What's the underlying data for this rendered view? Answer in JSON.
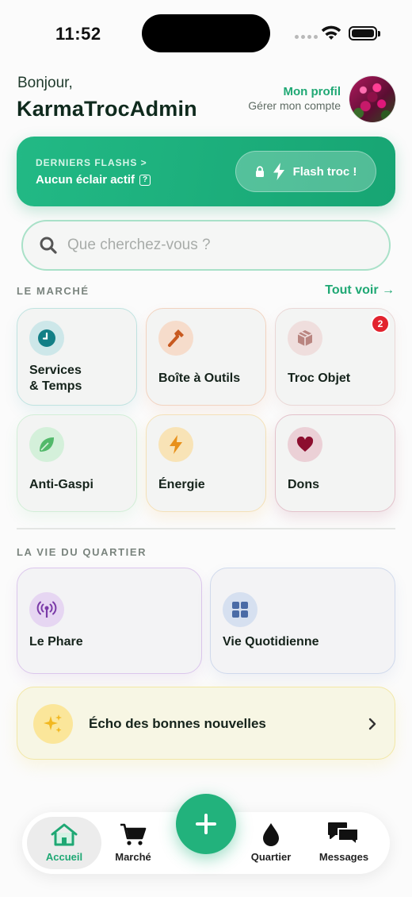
{
  "status_bar": {
    "time": "11:52"
  },
  "header": {
    "greeting": "Bonjour,",
    "username": "KarmaTrocAdmin",
    "profile_label": "Mon profil",
    "account_label": "Gérer mon compte"
  },
  "flash": {
    "title": "DERNIERS FLASHS >",
    "subtitle": "Aucun éclair actif",
    "help": "?",
    "button_label": "Flash troc !"
  },
  "search": {
    "placeholder": "Que cherchez-vous ?"
  },
  "market": {
    "section_label": "LE MARCHÉ",
    "see_all": "Tout voir →",
    "tiles": [
      {
        "label": "Services\n& Temps",
        "icon": "clock-icon",
        "color": "#127f86"
      },
      {
        "label": "Boîte à Outils",
        "icon": "hammer-icon",
        "color": "#c8591f"
      },
      {
        "label": "Troc Objet",
        "icon": "box-icon",
        "color": "#a8706a",
        "badge": "2"
      },
      {
        "label": "Anti-Gaspi",
        "icon": "leaf-icon",
        "color": "#52b96a"
      },
      {
        "label": "Énergie",
        "icon": "bolt-icon",
        "color": "#e89a16"
      },
      {
        "label": "Dons",
        "icon": "heart-icon",
        "color": "#8c0e2e"
      }
    ]
  },
  "neighborhood": {
    "section_label": "LA VIE DU QUARTIER",
    "tiles": [
      {
        "label": "Le Phare",
        "icon": "antenna-icon",
        "color": "#7a3aa8"
      },
      {
        "label": "Vie Quotidienne",
        "icon": "grid-icon",
        "color": "#4a6ba6"
      }
    ],
    "echo": {
      "label": "Écho des bonnes nouvelles",
      "icon": "sparkles-icon"
    }
  },
  "tab_bar": {
    "items": [
      {
        "label": "Accueil",
        "icon": "home-icon",
        "active": true
      },
      {
        "label": "Marché",
        "icon": "cart-icon"
      },
      {
        "label": "Quartier",
        "icon": "drop-icon"
      },
      {
        "label": "Messages",
        "icon": "chat-icon"
      }
    ],
    "fab_icon": "plus-icon"
  },
  "colors": {
    "accent": "#1fa874",
    "badge": "#e2232e"
  }
}
